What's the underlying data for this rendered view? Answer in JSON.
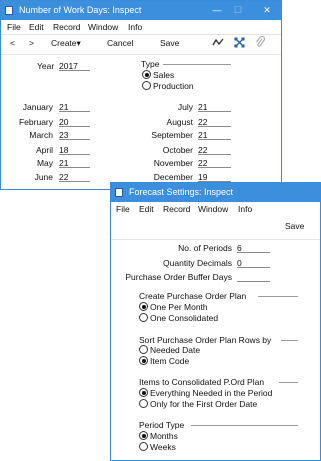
{
  "win1": {
    "title": "Number of Work Days: Inspect",
    "menu": [
      "File",
      "Edit",
      "Record",
      "Window",
      "Info"
    ],
    "toolbar": {
      "prev": "<",
      "next": ">",
      "create": "Create",
      "create_arrow": "▾",
      "cancel": "Cancel",
      "save": "Save"
    },
    "year_label": "Year",
    "year_value": "2017",
    "type_label": "Type",
    "type_options": [
      "Sales",
      "Production"
    ],
    "type_selected": "Sales",
    "months_left": [
      {
        "label": "January",
        "value": "21"
      },
      {
        "label": "February",
        "value": "20"
      },
      {
        "label": "March",
        "value": "23"
      },
      {
        "label": "April",
        "value": "18"
      },
      {
        "label": "May",
        "value": "21"
      },
      {
        "label": "June",
        "value": "22"
      }
    ],
    "months_right": [
      {
        "label": "July",
        "value": "21"
      },
      {
        "label": "August",
        "value": "22"
      },
      {
        "label": "September",
        "value": "21"
      },
      {
        "label": "October",
        "value": "22"
      },
      {
        "label": "November",
        "value": "22"
      },
      {
        "label": "December",
        "value": "19"
      }
    ]
  },
  "win2": {
    "title": "Forecast Settings: Inspect",
    "menu": [
      "File",
      "Edit",
      "Record",
      "Window",
      "Info"
    ],
    "save": "Save",
    "periods_label": "No. of Periods",
    "periods_value": "6",
    "qty_label": "Quantity Decimals",
    "qty_value": "0",
    "buffer_label": "Purchase Order Buffer Days",
    "buffer_value": "",
    "create_plan": {
      "label": "Create Purchase Order Plan",
      "options": [
        "One Per Month",
        "One Consolidated"
      ],
      "selected": "One Per Month"
    },
    "sort_rows": {
      "label": "Sort Purchase Order Plan Rows by",
      "options": [
        "Needed Date",
        "Item Code"
      ],
      "selected": "Item Code"
    },
    "items_cons": {
      "label": "Items to Consolidated P.Ord Plan",
      "options": [
        "Everything Needed in the Period",
        "Only for the First Order Date"
      ],
      "selected": "Everything Needed in the Period"
    },
    "period_type": {
      "label": "Period Type",
      "options": [
        "Months",
        "Weeks"
      ],
      "selected": "Months"
    }
  }
}
